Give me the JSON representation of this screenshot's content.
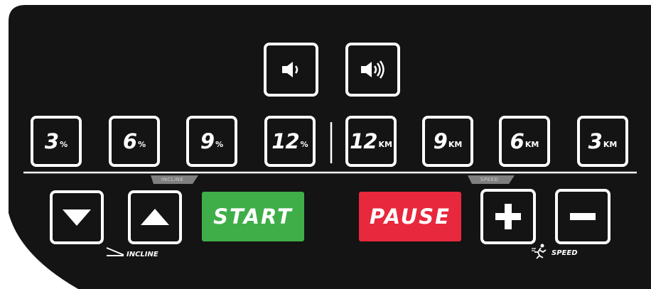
{
  "colors": {
    "panel": "#141414",
    "border": "#ffffff",
    "start": "#3fae49",
    "pause": "#e8283c",
    "tab": "#7f7f7f"
  },
  "volume": [
    {
      "icon": "speaker-low-icon"
    },
    {
      "icon": "speaker-high-icon"
    }
  ],
  "incline_presets": [
    {
      "value": "3",
      "unit": "%"
    },
    {
      "value": "6",
      "unit": "%"
    },
    {
      "value": "9",
      "unit": "%"
    },
    {
      "value": "12",
      "unit": "%"
    }
  ],
  "speed_presets": [
    {
      "value": "12",
      "unit": "KM"
    },
    {
      "value": "9",
      "unit": "KM"
    },
    {
      "value": "6",
      "unit": "KM"
    },
    {
      "value": "3",
      "unit": "KM"
    }
  ],
  "labels": {
    "incline_tab": "INCLINE",
    "speed_tab": "SPEED",
    "incline": "INCLINE",
    "speed": "SPEED",
    "start": "START",
    "pause": "PAUSE"
  },
  "controls": {
    "incline_down_icon": "triangle-down-icon",
    "incline_up_icon": "triangle-up-icon",
    "speed_up_icon": "plus-icon",
    "speed_down_icon": "minus-icon"
  }
}
